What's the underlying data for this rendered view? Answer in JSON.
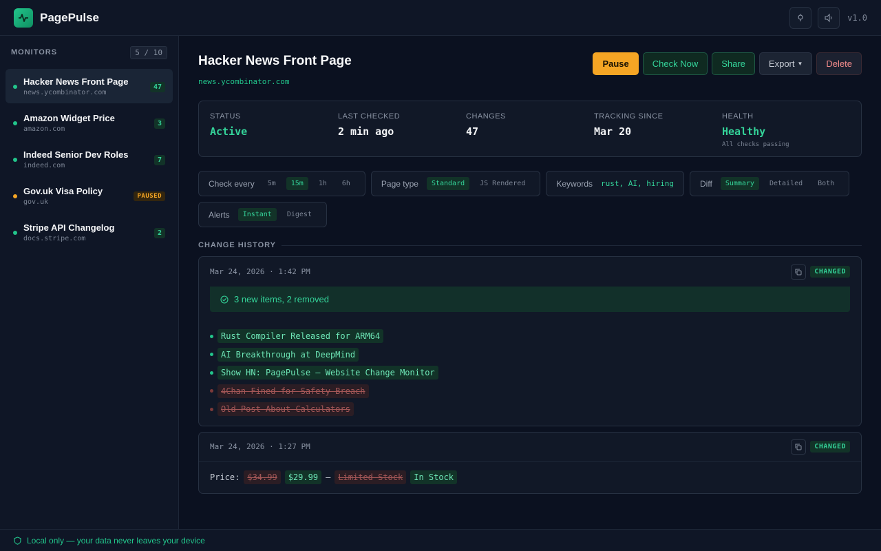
{
  "app": {
    "name": "PagePulse",
    "version": "v1.0"
  },
  "sidebar": {
    "title": "MONITORS",
    "count": "5 / 10",
    "items": [
      {
        "name": "Hacker News Front Page",
        "url": "news.ycombinator.com",
        "badge": "47",
        "status": "active"
      },
      {
        "name": "Amazon Widget Price",
        "url": "amazon.com",
        "badge": "3",
        "status": "active"
      },
      {
        "name": "Indeed Senior Dev Roles",
        "url": "indeed.com",
        "badge": "7",
        "status": "active"
      },
      {
        "name": "Gov.uk Visa Policy",
        "url": "gov.uk",
        "badge": "PAUSED",
        "status": "paused"
      },
      {
        "name": "Stripe API Changelog",
        "url": "docs.stripe.com",
        "badge": "2",
        "status": "active"
      }
    ]
  },
  "footer": {
    "text": "Local only — your data never leaves your device"
  },
  "main": {
    "title": "Hacker News Front Page",
    "url": "news.ycombinator.com",
    "actions": {
      "pause": "Pause",
      "check": "Check Now",
      "share": "Share",
      "export": "Export",
      "delete": "Delete"
    },
    "stats": {
      "status": {
        "label": "STATUS",
        "value": "Active"
      },
      "last_checked": {
        "label": "LAST CHECKED",
        "value": "2 min ago"
      },
      "changes": {
        "label": "CHANGES",
        "value": "47"
      },
      "tracking": {
        "label": "TRACKING SINCE",
        "value": "Mar 20"
      },
      "health": {
        "label": "HEALTH",
        "value": "Healthy",
        "sub": "All checks passing"
      }
    },
    "options": {
      "check_every": {
        "label": "Check every",
        "choices": [
          "5m",
          "15m",
          "1h",
          "6h"
        ],
        "selected": "15m"
      },
      "page_type": {
        "label": "Page type",
        "choices": [
          "Standard",
          "JS Rendered"
        ],
        "selected": "Standard"
      },
      "keywords": {
        "label": "Keywords",
        "value": "rust, AI, hiring"
      },
      "diff": {
        "label": "Diff",
        "choices": [
          "Summary",
          "Detailed",
          "Both"
        ],
        "selected": "Summary"
      },
      "alerts": {
        "label": "Alerts",
        "choices": [
          "Instant",
          "Digest"
        ],
        "selected": "Instant"
      }
    },
    "history_title": "CHANGE HISTORY",
    "history": [
      {
        "time": "Mar 24, 2026 · 1:42 PM",
        "badge": "CHANGED",
        "summary": "3 new items, 2 removed",
        "added": [
          "Rust Compiler Released for ARM64",
          "AI Breakthrough at DeepMind",
          "Show HN: PagePulse — Website Change Monitor"
        ],
        "removed": [
          "4Chan Fined for Safety Breach",
          "Old Post About Calculators"
        ]
      },
      {
        "time": "Mar 24, 2026 · 1:27 PM",
        "badge": "CHANGED",
        "price_label": "Price:",
        "old_price": "$34.99",
        "new_price": "$29.99",
        "separator": "—",
        "old_stock": "Limited Stock",
        "new_stock": "In Stock"
      }
    ]
  },
  "colors": {
    "accent": "#22c58b",
    "pause": "#f5a524",
    "background": "#0b1120"
  }
}
